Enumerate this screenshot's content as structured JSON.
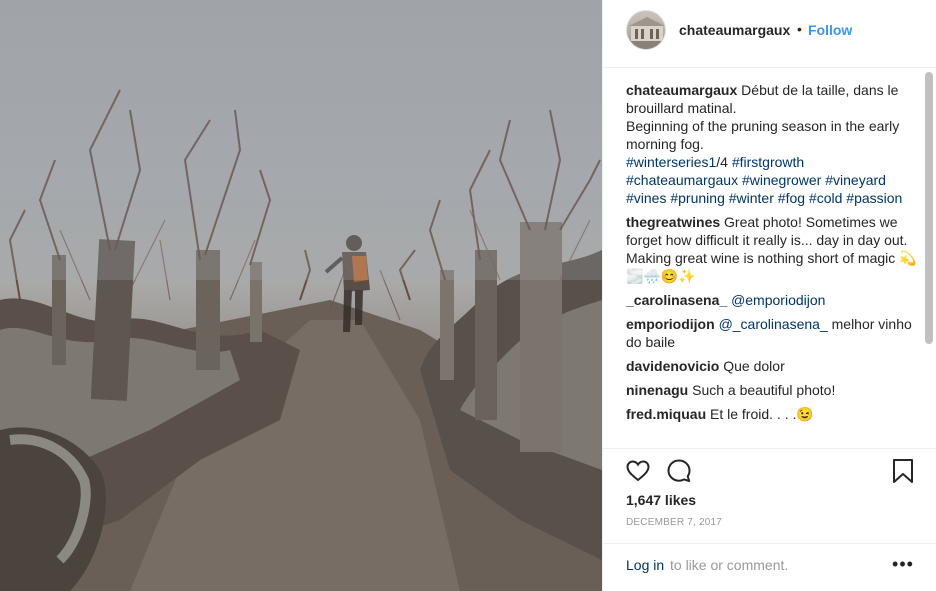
{
  "header": {
    "username": "chateaumargaux",
    "separator": "•",
    "follow_label": "Follow"
  },
  "caption": {
    "username": "chateaumargaux",
    "text_fr": "Début de la taille, dans le brouillard matinal.",
    "text_en": "Beginning of the pruning season in the early morning fog.",
    "hashtags": [
      "#winterseries1",
      "/4 ",
      "#firstgrowth",
      "#chateaumargaux",
      "#winegrower",
      "#vineyard",
      "#vines",
      "#pruning",
      "#winter",
      "#fog",
      "#cold",
      "#passion"
    ]
  },
  "comments": [
    {
      "username": "thegreatwines",
      "text": "Great photo! Sometimes we forget how difficult it really is... day in day out. Making great wine is nothing short of magic 💫🌫️🌧️😊✨"
    },
    {
      "username": "_carolinasena_",
      "mention": "@emporiodijon",
      "text": ""
    },
    {
      "username": "emporiodijon",
      "mention": "@_carolinasena_",
      "text": " melhor vinho do baile"
    },
    {
      "username": "davidenovicio",
      "text": "Que dolor"
    },
    {
      "username": "ninenagu",
      "text": "Such a beautiful photo!"
    },
    {
      "username": "fred.miquau",
      "text": "Et le froid. . . .😉"
    }
  ],
  "likes": "1,647 likes",
  "date": "DECEMBER 7, 2017",
  "footer": {
    "login_label": "Log in",
    "rest_text": "to like or comment.",
    "more_label": "•••"
  },
  "icons": {
    "like": "heart-icon",
    "comment": "comment-bubble-icon",
    "save": "bookmark-icon",
    "more": "more-options-icon"
  }
}
